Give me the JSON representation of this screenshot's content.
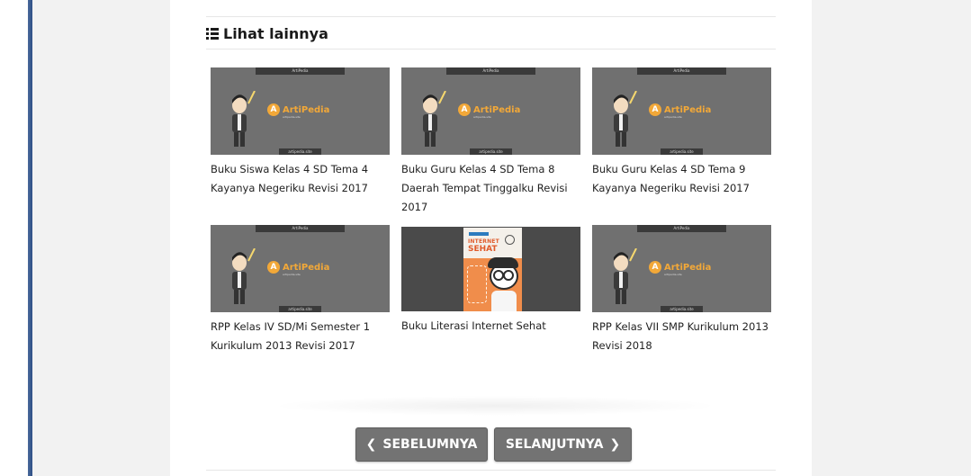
{
  "section": {
    "heading": "Lihat lainnya"
  },
  "posts": [
    {
      "title": "Buku Siswa Kelas 4 SD Tema 4 Kayanya Negeriku Revisi 2017",
      "thumb": {
        "top_tag": "ArtiPedia",
        "brand": "ArtiPedia",
        "brand_sub": "artipedia.site",
        "bottom_tag": "artipedia.site"
      }
    },
    {
      "title": "Buku Guru Kelas 4 SD Tema 8 Daerah Tempat Tinggalku Revisi 2017",
      "thumb": {
        "top_tag": "ArtiPedia",
        "brand": "ArtiPedia",
        "brand_sub": "artipedia.site",
        "bottom_tag": "artipedia.site"
      }
    },
    {
      "title": "Buku Guru Kelas 4 SD Tema 9 Kayanya Negeriku Revisi 2017",
      "thumb": {
        "top_tag": "ArtiPedia",
        "brand": "ArtiPedia",
        "brand_sub": "artipedia.site",
        "bottom_tag": "artipedia.site"
      }
    },
    {
      "title": "RPP Kelas IV SD/Mi Semester 1 Kurikulum 2013 Revisi 2017",
      "thumb": {
        "top_tag": "ArtiPedia",
        "brand": "ArtiPedia",
        "brand_sub": "artipedia.site",
        "bottom_tag": "artipedia.site"
      }
    },
    {
      "title": "Buku Literasi Internet Sehat",
      "thumb": {
        "cover_line1": "INTERNET",
        "cover_line2": "SEHAT"
      }
    },
    {
      "title": "RPP Kelas VII SMP Kurikulum 2013 Revisi 2018",
      "thumb": {
        "top_tag": "ArtiPedia",
        "brand": "ArtiPedia",
        "brand_sub": "artipedia.site",
        "bottom_tag": "artipedia.site"
      }
    }
  ],
  "pagination": {
    "prev_label": "SEBELUMNYA",
    "next_label": "SELANJUTNYA",
    "prev_icon": "chevron-left-icon",
    "next_icon": "chevron-right-icon"
  },
  "colors": {
    "thumb_bg": "#707070",
    "brand_orange": "#f2a838",
    "button_bg": "#737373",
    "accent_rail": "#2e4f86"
  }
}
